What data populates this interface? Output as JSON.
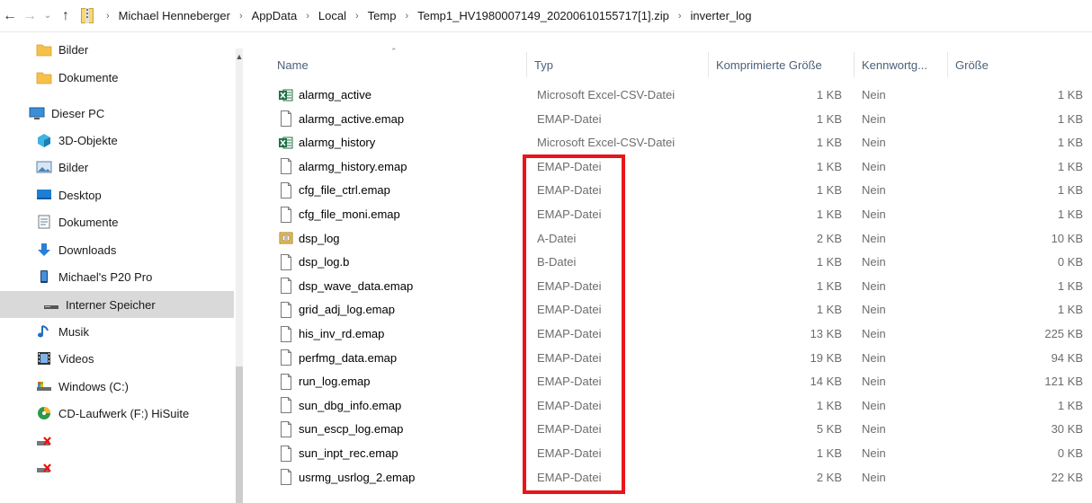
{
  "address": {
    "crumbs": [
      "Michael Henneberger",
      "AppData",
      "Local",
      "Temp",
      "Temp1_HV1980007149_20200610155717[1].zip",
      "inverter_log"
    ]
  },
  "nav": {
    "items": [
      {
        "label": "Bilder",
        "icon": "folder-icon"
      },
      {
        "label": "Dokumente",
        "icon": "folder-icon"
      },
      {
        "label": "Dieser PC",
        "icon": "computer-icon"
      },
      {
        "label": "3D-Objekte",
        "icon": "cube-icon"
      },
      {
        "label": "Bilder",
        "icon": "pictures-icon"
      },
      {
        "label": "Desktop",
        "icon": "desktop-icon"
      },
      {
        "label": "Dokumente",
        "icon": "documents-icon"
      },
      {
        "label": "Downloads",
        "icon": "download-icon"
      },
      {
        "label": "Michael's P20 Pro",
        "icon": "phone-icon"
      },
      {
        "label": "Interner Speicher",
        "icon": "drive-icon"
      },
      {
        "label": "Musik",
        "icon": "music-icon"
      },
      {
        "label": "Videos",
        "icon": "film-icon"
      },
      {
        "label": "Windows (C:)",
        "icon": "hard-drive-icon"
      },
      {
        "label": "CD-Laufwerk (F:) HiSuite",
        "icon": "cd-drive-icon"
      },
      {
        "label": "",
        "icon": "disconnected-drive-icon"
      },
      {
        "label": "",
        "icon": "disconnected-drive-icon"
      }
    ]
  },
  "columns": {
    "name": "Name",
    "type": "Typ",
    "compressed": "Komprimierte Größe",
    "password": "Kennwortg...",
    "size": "Größe"
  },
  "files": [
    {
      "name": "alarmg_active",
      "type": "Microsoft Excel-CSV-Datei",
      "compressed": "1 KB",
      "password": "Nein",
      "size": "1 KB",
      "icon": "excel-csv-icon"
    },
    {
      "name": "alarmg_active.emap",
      "type": "EMAP-Datei",
      "compressed": "1 KB",
      "password": "Nein",
      "size": "1 KB",
      "icon": "file-icon"
    },
    {
      "name": "alarmg_history",
      "type": "Microsoft Excel-CSV-Datei",
      "compressed": "1 KB",
      "password": "Nein",
      "size": "1 KB",
      "icon": "excel-csv-icon"
    },
    {
      "name": "alarmg_history.emap",
      "type": "EMAP-Datei",
      "compressed": "1 KB",
      "password": "Nein",
      "size": "1 KB",
      "icon": "file-icon"
    },
    {
      "name": "cfg_file_ctrl.emap",
      "type": "EMAP-Datei",
      "compressed": "1 KB",
      "password": "Nein",
      "size": "1 KB",
      "icon": "file-icon"
    },
    {
      "name": "cfg_file_moni.emap",
      "type": "EMAP-Datei",
      "compressed": "1 KB",
      "password": "Nein",
      "size": "1 KB",
      "icon": "file-icon"
    },
    {
      "name": "dsp_log",
      "type": "A-Datei",
      "compressed": "2 KB",
      "password": "Nein",
      "size": "10 KB",
      "icon": "archive-icon"
    },
    {
      "name": "dsp_log.b",
      "type": "B-Datei",
      "compressed": "1 KB",
      "password": "Nein",
      "size": "0 KB",
      "icon": "file-icon"
    },
    {
      "name": "dsp_wave_data.emap",
      "type": "EMAP-Datei",
      "compressed": "1 KB",
      "password": "Nein",
      "size": "1 KB",
      "icon": "file-icon"
    },
    {
      "name": "grid_adj_log.emap",
      "type": "EMAP-Datei",
      "compressed": "1 KB",
      "password": "Nein",
      "size": "1 KB",
      "icon": "file-icon"
    },
    {
      "name": "his_inv_rd.emap",
      "type": "EMAP-Datei",
      "compressed": "13 KB",
      "password": "Nein",
      "size": "225 KB",
      "icon": "file-icon"
    },
    {
      "name": "perfmg_data.emap",
      "type": "EMAP-Datei",
      "compressed": "19 KB",
      "password": "Nein",
      "size": "94 KB",
      "icon": "file-icon"
    },
    {
      "name": "run_log.emap",
      "type": "EMAP-Datei",
      "compressed": "14 KB",
      "password": "Nein",
      "size": "121 KB",
      "icon": "file-icon"
    },
    {
      "name": "sun_dbg_info.emap",
      "type": "EMAP-Datei",
      "compressed": "1 KB",
      "password": "Nein",
      "size": "1 KB",
      "icon": "file-icon"
    },
    {
      "name": "sun_escp_log.emap",
      "type": "EMAP-Datei",
      "compressed": "5 KB",
      "password": "Nein",
      "size": "30 KB",
      "icon": "file-icon"
    },
    {
      "name": "sun_inpt_rec.emap",
      "type": "EMAP-Datei",
      "compressed": "1 KB",
      "password": "Nein",
      "size": "0 KB",
      "icon": "file-icon"
    },
    {
      "name": "usrmg_usrlog_2.emap",
      "type": "EMAP-Datei",
      "compressed": "2 KB",
      "password": "Nein",
      "size": "22 KB",
      "icon": "file-icon"
    }
  ],
  "colors": {
    "highlight": "#e8151b",
    "selected": "#d9d9d9",
    "header_text": "#4c607a",
    "folder": "#f6c04a",
    "excel": "#1d7044"
  }
}
